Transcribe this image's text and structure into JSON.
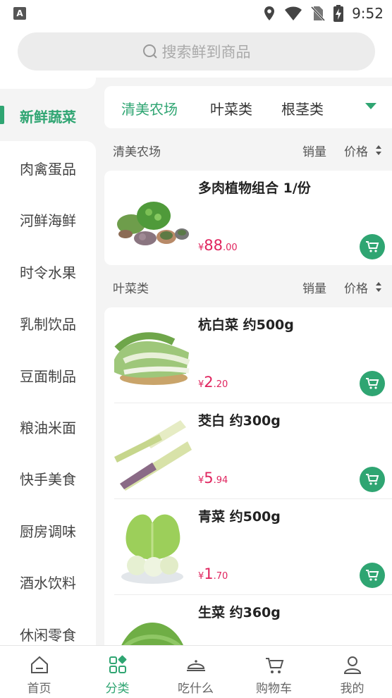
{
  "status": {
    "a_icon": "A",
    "time": "9:52"
  },
  "search": {
    "placeholder": "搜索鲜到商品"
  },
  "sidebar": {
    "items": [
      {
        "label": "新鲜蔬菜"
      },
      {
        "label": "肉禽蛋品"
      },
      {
        "label": "河鲜海鲜"
      },
      {
        "label": "时令水果"
      },
      {
        "label": "乳制饮品"
      },
      {
        "label": "豆面制品"
      },
      {
        "label": "粮油米面"
      },
      {
        "label": "快手美食"
      },
      {
        "label": "厨房调味"
      },
      {
        "label": "酒水饮料"
      },
      {
        "label": "休闲零食"
      }
    ]
  },
  "tabs": [
    {
      "label": "清美农场"
    },
    {
      "label": "叶菜类"
    },
    {
      "label": "根茎类"
    }
  ],
  "sections": [
    {
      "title": "清美农场",
      "sales_label": "销量",
      "price_label": "价格",
      "products": [
        {
          "name": "多肉植物组合 1/份",
          "currency": "¥",
          "price_int": "88",
          "price_dec": ".00",
          "image": "succulent-plants"
        }
      ]
    },
    {
      "title": "叶菜类",
      "sales_label": "销量",
      "price_label": "价格",
      "products": [
        {
          "name": "杭白菜 约500g",
          "currency": "¥",
          "price_int": "2",
          "price_dec": ".20",
          "image": "bok-choy"
        },
        {
          "name": "茭白 约300g",
          "currency": "¥",
          "price_int": "5",
          "price_dec": ".94",
          "image": "water-bamboo"
        },
        {
          "name": "青菜 约500g",
          "currency": "¥",
          "price_int": "1",
          "price_dec": ".70",
          "image": "green-vegetable"
        },
        {
          "name": "生菜 约360g",
          "image": "lettuce"
        }
      ]
    }
  ],
  "bottom_nav": [
    {
      "label": "首页",
      "icon": "home-icon"
    },
    {
      "label": "分类",
      "icon": "category-icon"
    },
    {
      "label": "吃什么",
      "icon": "dish-icon"
    },
    {
      "label": "购物车",
      "icon": "cart-icon"
    },
    {
      "label": "我的",
      "icon": "profile-icon"
    }
  ],
  "colors": {
    "accent": "#2fa572",
    "price": "#e0245e",
    "background": "#f4f4f4"
  }
}
